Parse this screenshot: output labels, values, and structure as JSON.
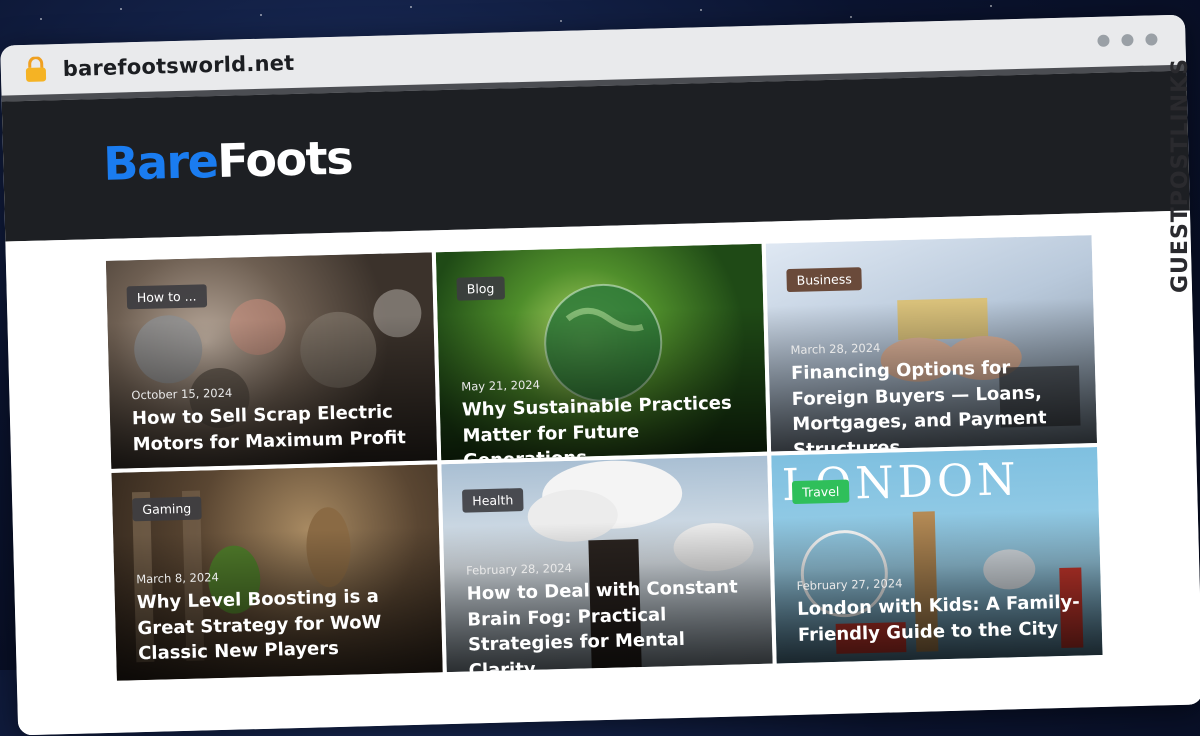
{
  "browser": {
    "url": "barefootsworld.net",
    "lock_icon": "lock-icon"
  },
  "site": {
    "logo_part1": "Bare",
    "logo_part2": "Foots",
    "brand_blue": "#1a7cf0"
  },
  "side_brand": "GUESTPOSTLINKS",
  "cards": [
    {
      "category": "How to ...",
      "date": "October 15, 2024",
      "title": "How to Sell Scrap Electric Motors for Maximum Profit"
    },
    {
      "category": "Blog",
      "date": "May 21, 2024",
      "title": "Why Sustainable Practices Matter for Future Generations"
    },
    {
      "category": "Business",
      "date": "March 28, 2024",
      "title": "Financing Options for Foreign Buyers — Loans, Mortgages, and Payment Structures"
    },
    {
      "category": "Gaming",
      "date": "March 8, 2024",
      "title": "Why Level Boosting is a Great Strategy for WoW Classic New Players"
    },
    {
      "category": "Health",
      "date": "February 28, 2024",
      "title": "How to Deal with Constant Brain Fog: Practical Strategies for Mental Clarity"
    },
    {
      "category": "Travel",
      "date": "February 27, 2024",
      "title": "London with Kids: A Family-Friendly Guide to the City"
    }
  ]
}
